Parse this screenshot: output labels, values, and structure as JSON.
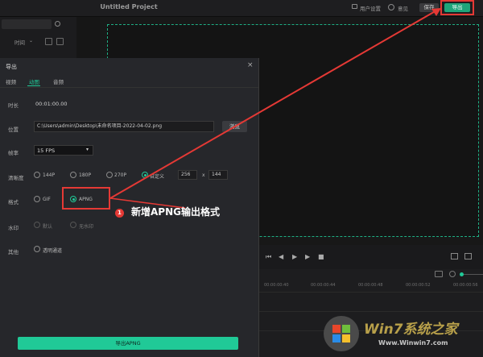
{
  "titlebar": {
    "title": "Untitled Project",
    "user_settings": "用户设置",
    "feedback": "意见",
    "save": "保存",
    "export": "导出"
  },
  "left_panel": {
    "sort_label": "时间"
  },
  "timeline": {
    "ticks": [
      "00:00:00:40",
      "00:00:00:44",
      "00:00:00:48",
      "00:00:00:52",
      "00:00:00:56"
    ]
  },
  "dialog": {
    "title": "导出",
    "tabs": [
      {
        "label": "视频",
        "active": false
      },
      {
        "label": "动图",
        "active": true
      },
      {
        "label": "音频",
        "active": false
      }
    ],
    "duration_label": "时长",
    "duration_value": "00:01:00.00",
    "location_label": "位置",
    "location_value": "C:\\Users\\admin\\Desktop\\未命名项目-2022-04-02.png",
    "browse_label": "浏览",
    "framerate_label": "帧率",
    "framerate_value": "15 FPS",
    "resolution_label": "清晰度",
    "resolution_options": [
      "144P",
      "180P",
      "270P",
      "自定义"
    ],
    "resolution_selected": "自定义",
    "custom_width": "256",
    "custom_x": "x",
    "custom_height": "144",
    "format_label": "格式",
    "format_options": [
      "GIF",
      "APNG"
    ],
    "format_selected": "APNG",
    "watermark_label": "水印",
    "watermark_options": [
      "默认",
      "无水印"
    ],
    "other_label": "其他",
    "other_option": "透明通道",
    "export_button": "导出APNG"
  },
  "annotation": {
    "badge": "1",
    "text": "新增APNG输出格式"
  },
  "watermark_site": {
    "brand": "Win7系统之家",
    "url": "Www.Winwin7.com"
  },
  "colors": {
    "accent": "#20c997",
    "annotation_red": "#e53935"
  }
}
